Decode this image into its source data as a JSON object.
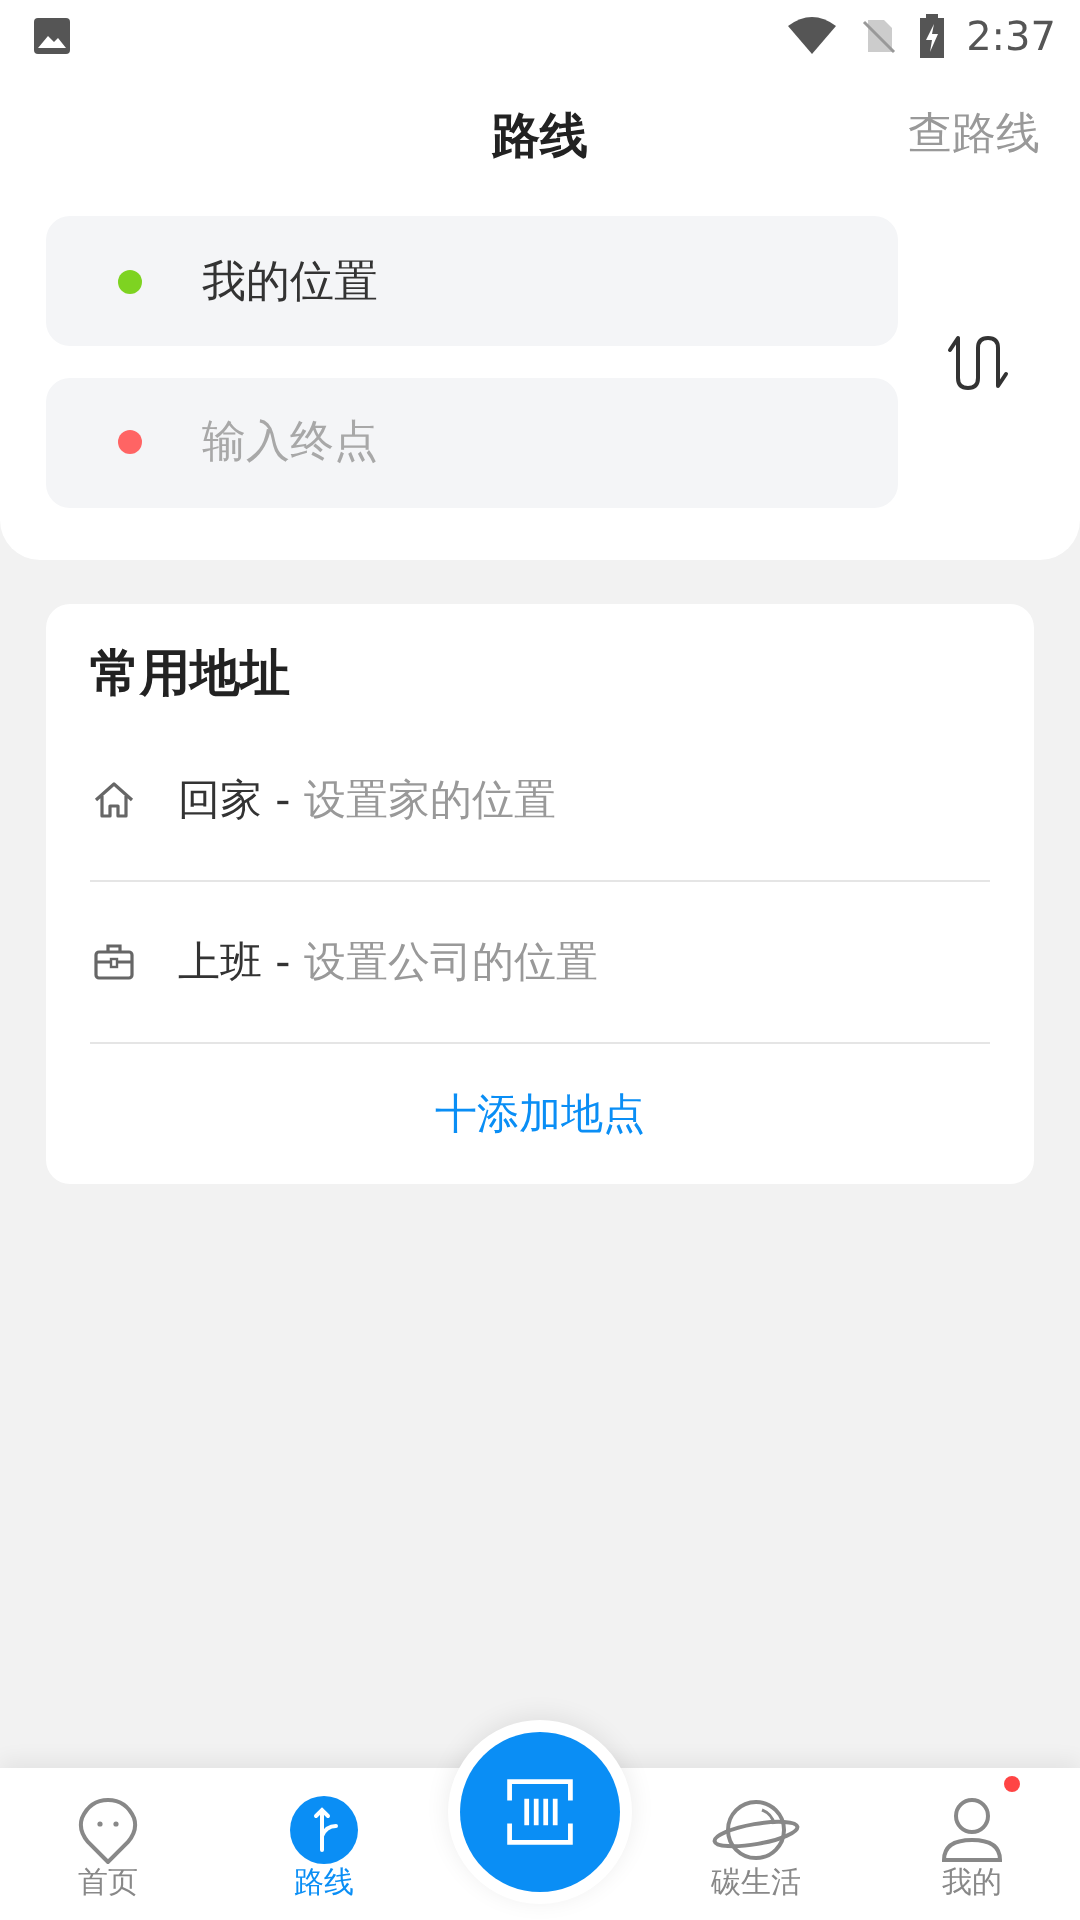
{
  "status_bar": {
    "time": "2:37"
  },
  "header": {
    "title": "路线",
    "action": "查路线"
  },
  "route": {
    "origin": {
      "value": "我的位置",
      "color": "#7ed321"
    },
    "destination": {
      "placeholder": "输入终点",
      "color": "#ff6464"
    }
  },
  "common_addresses": {
    "title": "常用地址",
    "items": [
      {
        "kind": "home",
        "name": "回家",
        "separator": "-",
        "hint": "设置家的位置"
      },
      {
        "kind": "work",
        "name": "上班",
        "separator": "-",
        "hint": "设置公司的位置"
      }
    ],
    "add_button": "十添加地点"
  },
  "nav": [
    {
      "kind": "home",
      "label": "首页",
      "selected": false,
      "badge": false
    },
    {
      "kind": "route",
      "label": "路线",
      "selected": true,
      "badge": false
    },
    {
      "kind": "scan",
      "selected": false,
      "badge": false
    },
    {
      "kind": "planet",
      "label": "碳生活",
      "selected": false,
      "badge": false
    },
    {
      "kind": "user",
      "label": "我的",
      "selected": false,
      "badge": true
    }
  ]
}
